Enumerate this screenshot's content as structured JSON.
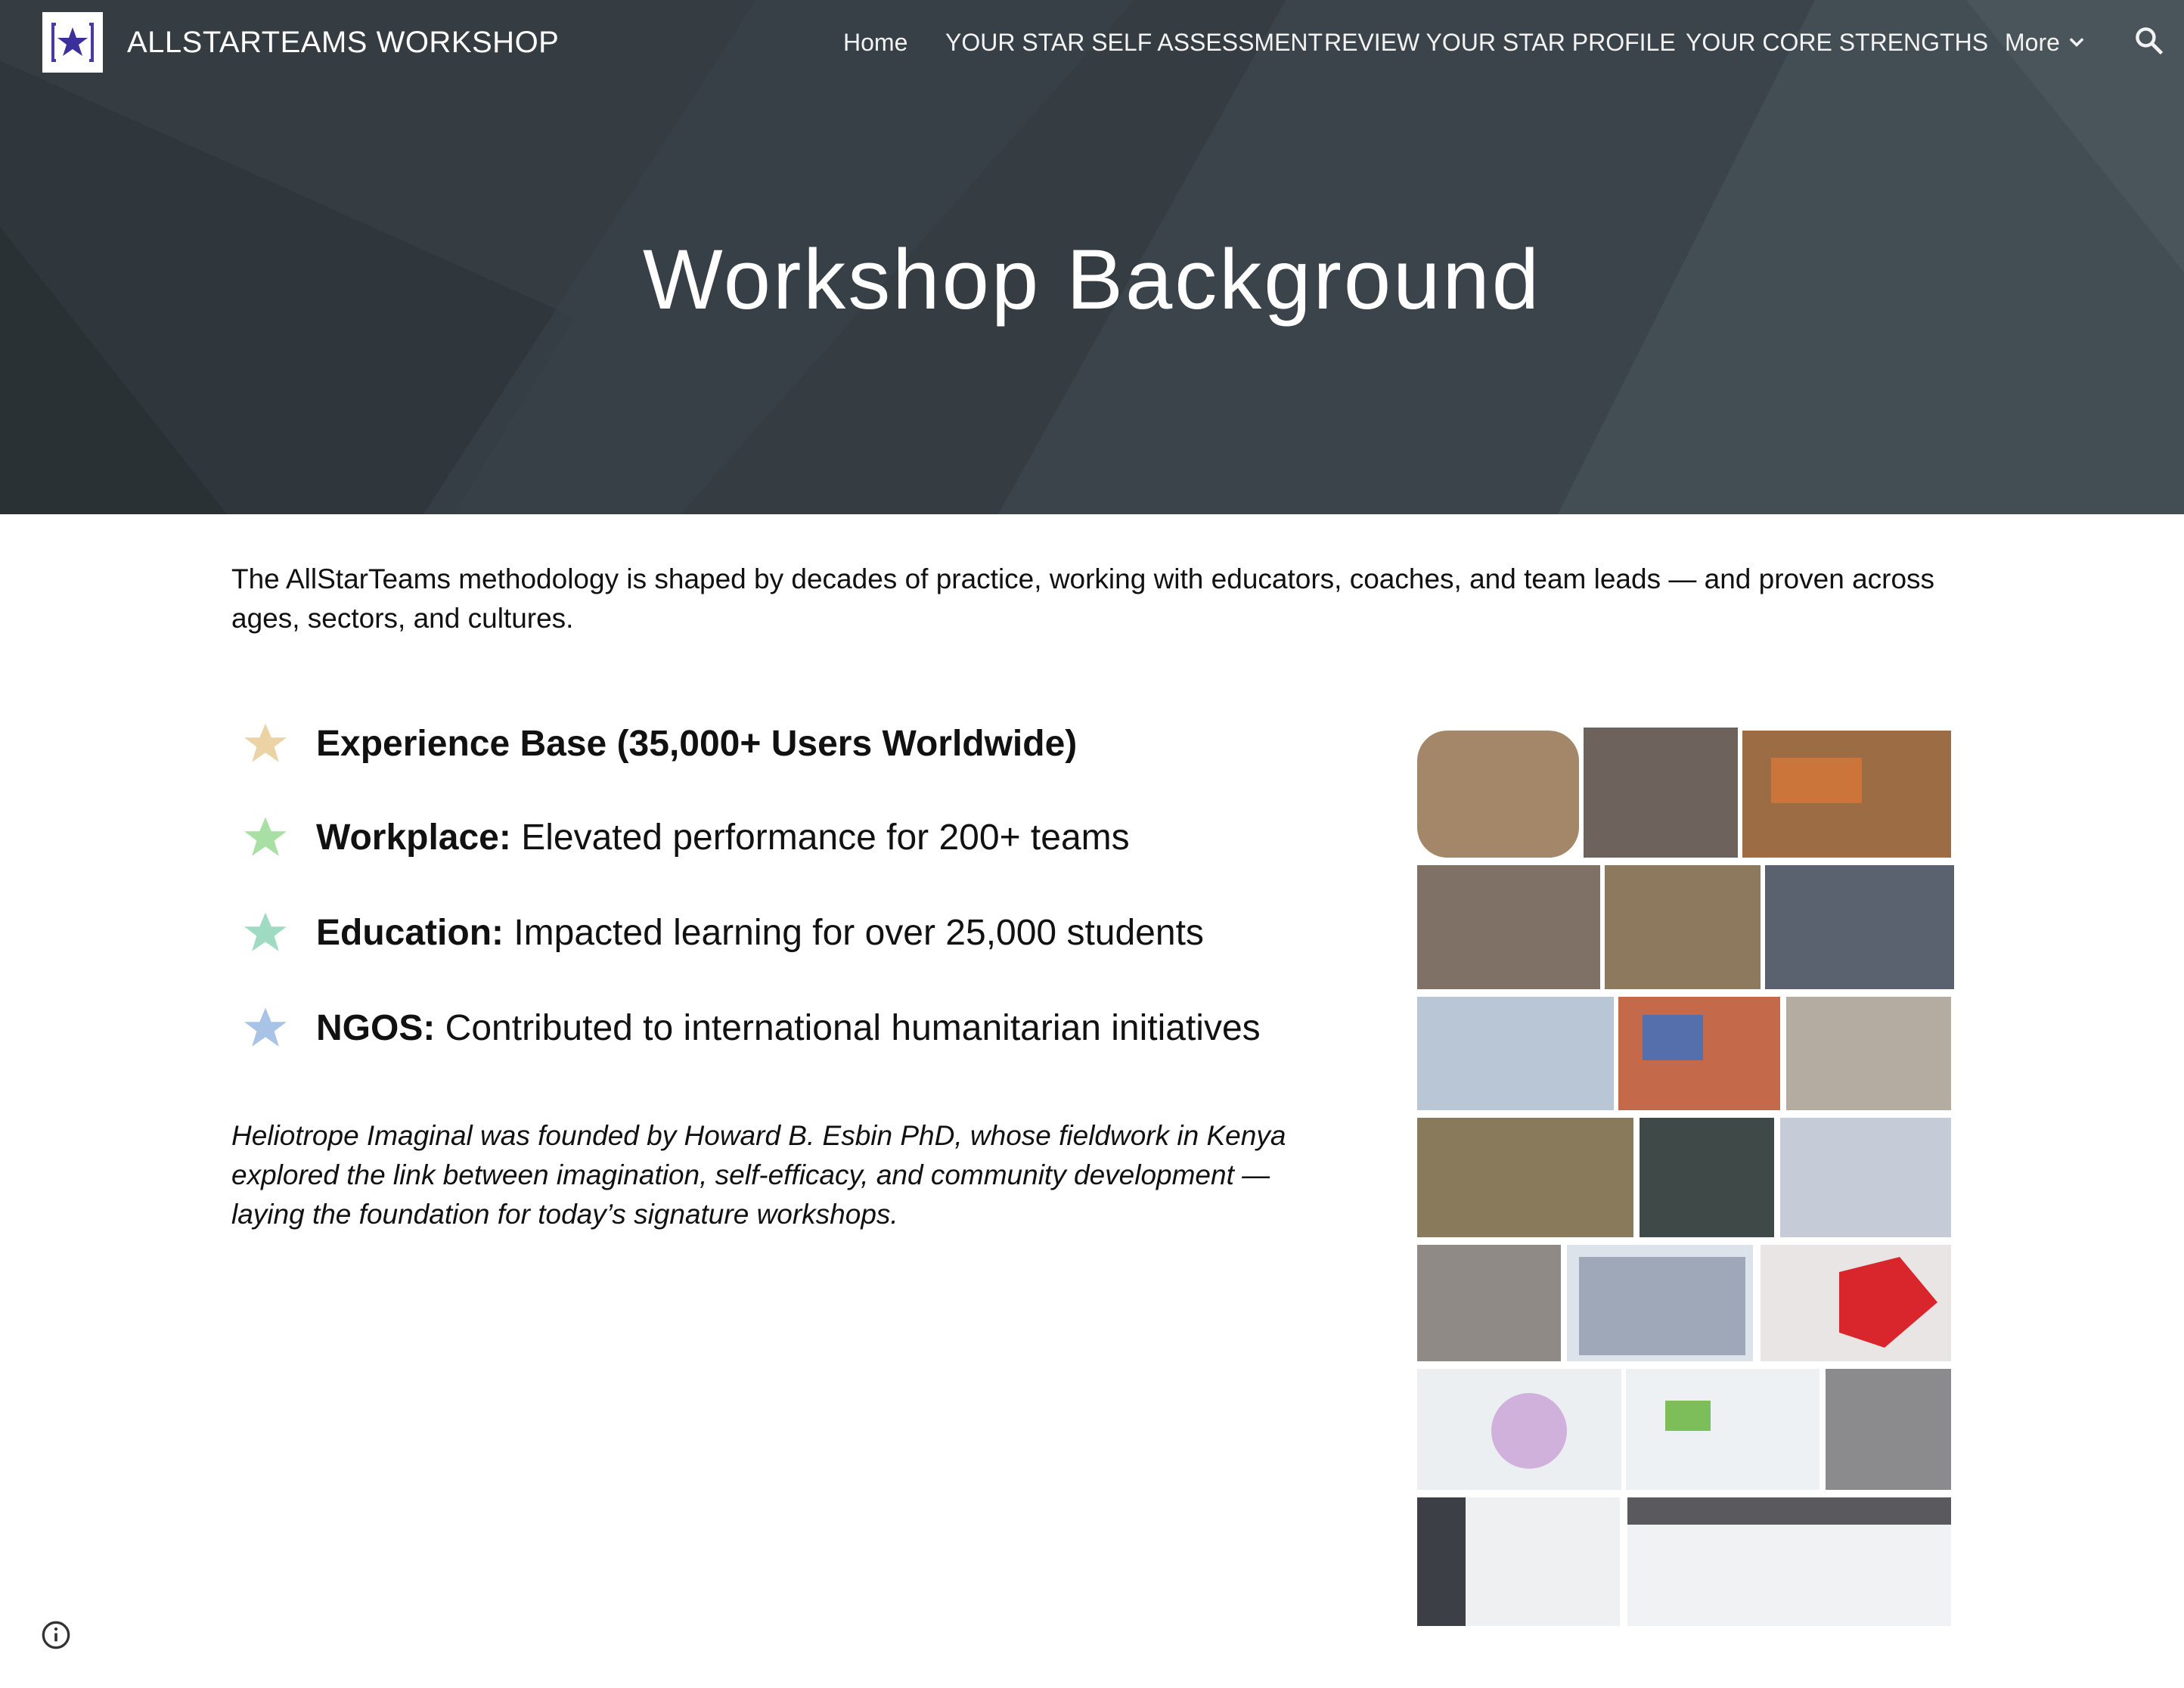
{
  "site": {
    "title": "ALLSTARTEAMS WORKSHOP",
    "logo_icon": "star-logo-icon"
  },
  "nav": {
    "items": [
      {
        "label": "Home"
      },
      {
        "label": "YOUR STAR SELF ASSESSMENT"
      },
      {
        "label": "REVIEW YOUR STAR PROFILE"
      },
      {
        "label": "YOUR CORE STRENGTHS"
      },
      {
        "label": "More"
      }
    ],
    "search_icon": "search-icon"
  },
  "page": {
    "title": "Workshop Background",
    "intro": "The AllStarTeams methodology is shaped by decades of practice, working with educators, coaches, and team leads — and proven across ages, sectors, and cultures."
  },
  "stats": {
    "heading": "Experience Base (35,000+ Users Worldwide)",
    "items": [
      {
        "key": "Workplace:",
        "text": " Elevated performance for 200+ teams"
      },
      {
        "key": "Education:",
        "text": " Impacted learning for over 25,000 students"
      },
      {
        "key": "NGOS:",
        "text": " Contributed to international humanitarian initiatives"
      }
    ]
  },
  "founder_note": "Heliotrope Imaginal was founded by Howard B. Esbin PhD, whose fieldwork in Kenya explored the link between imagination, self-efficacy, and community development — laying the foundation for today’s signature workshops.",
  "colors": {
    "hero_bg": "#3a4248",
    "logo_star": "#4b3aa6",
    "star_gold": "#ecd3a5",
    "star_green": "#a8dfa2",
    "star_teal": "#9fdbc2",
    "star_blue": "#a9c3e6"
  },
  "footer": {
    "info_icon": "info-icon"
  }
}
